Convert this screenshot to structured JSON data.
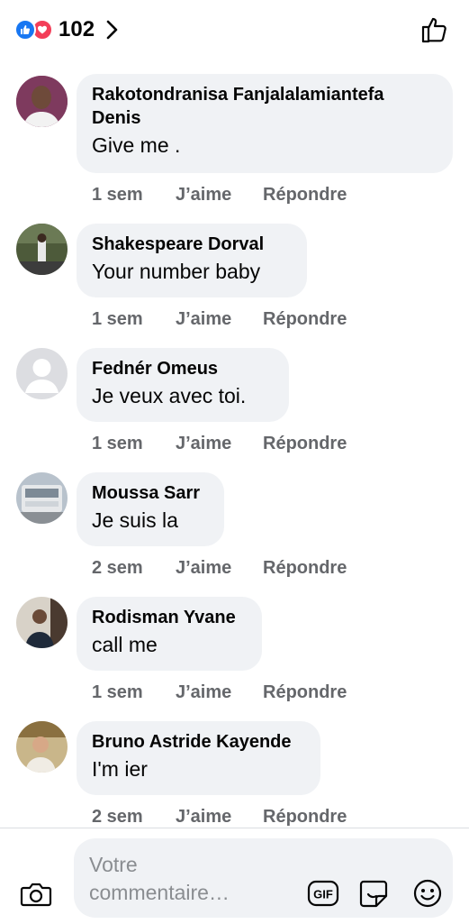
{
  "reactions": {
    "count": "102"
  },
  "comments": [
    {
      "author": "Rakotondranisa Fanjalalamiantefa Denis",
      "text": "Give me .",
      "time": "1 sem",
      "like": "J’aime",
      "reply": "Répondre"
    },
    {
      "author": "Shakespeare Dorval",
      "text": "Your number baby",
      "time": "1 sem",
      "like": "J’aime",
      "reply": "Répondre"
    },
    {
      "author": "Fednér Omeus",
      "text": "Je veux avec toi.",
      "time": "1 sem",
      "like": "J’aime",
      "reply": "Répondre"
    },
    {
      "author": "Moussa Sarr",
      "text": "Je suis la",
      "time": "2 sem",
      "like": "J’aime",
      "reply": "Répondre"
    },
    {
      "author": "Rodisman Yvane",
      "text": "call me",
      "time": "1 sem",
      "like": "J’aime",
      "reply": "Répondre"
    },
    {
      "author": "Bruno Astride Kayende",
      "text": "I'm ier",
      "time": "2 sem",
      "like": "J’aime",
      "reply": "Répondre"
    }
  ],
  "composer": {
    "placeholder": "Votre commentaire…",
    "gif_label": "GIF"
  },
  "colors": {
    "like_blue": "#1877f2",
    "love_red": "#f33e58",
    "bubble": "#f0f2f5",
    "meta_gray": "#65676b"
  }
}
